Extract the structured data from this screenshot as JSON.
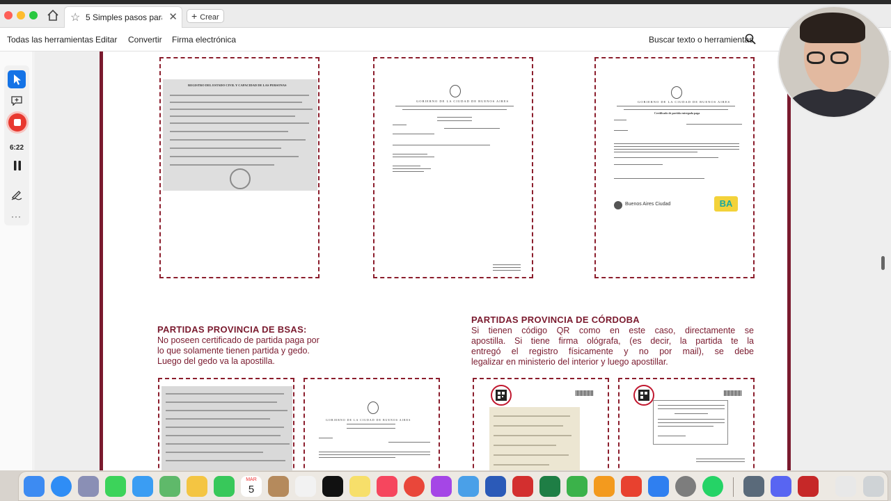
{
  "browser": {
    "tab_title": "5 Simples pasos para a...",
    "create_label": "Crear"
  },
  "toolbar": {
    "all_tools": "Todas las herramientas",
    "edit": "Editar",
    "convert": "Convertir",
    "e_sign": "Firma electrónica",
    "search_tools": "Buscar texto o herramientas"
  },
  "recording": {
    "time": "6:22"
  },
  "sections": {
    "bsas": {
      "title": "PARTIDAS PROVINCIA DE BSAS:",
      "body": [
        "No poseen certificado de partida paga por",
        "lo que solamente tienen partida y gedo.",
        "Luego del gedo va la apostilla."
      ]
    },
    "cordoba": {
      "title": "PARTIDAS PROVINCIA DE CÓRDOBA",
      "body": [
        "Si tienen código QR como en este caso, directamente se",
        "apostilla. Si tiene firma ológrafa, (es decir, la partida te la",
        "entregó el registro físicamente y no por mail), se debe",
        "legalizar en ministerio del interior y luego apostillar."
      ]
    }
  },
  "thumbnails": {
    "registro_header": "REGISTRO DEL ESTADO CIVIL Y CAPACIDAD DE LAS PERSONAS",
    "gob_header": "GOBIERNO DE LA CIUDAD DE BUENOS AIRES",
    "ba_ciudad": "Buenos Aires Ciudad",
    "ba_logo": "BA",
    "cert_title": "Certificado de partida entregada paga"
  },
  "dock": {
    "calendar_month": "MAR",
    "calendar_day": "5"
  },
  "colors": {
    "accent": "#7a1a2e",
    "frame": "#8b1d2c",
    "adobe_blue": "#1473e6",
    "record_red": "#e8382f"
  }
}
